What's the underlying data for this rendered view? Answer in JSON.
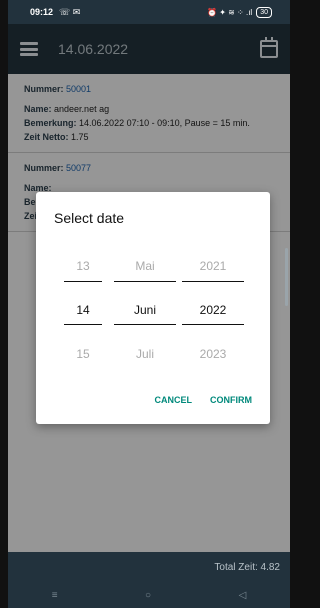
{
  "status_bar": {
    "time": "09:12",
    "left_icons": "☏ ✉",
    "right_icons": "⏰ ✦ ≋ ⁘ .ıl",
    "battery": "30"
  },
  "app_bar": {
    "date": "14.06.2022"
  },
  "entries": [
    {
      "nummer_label": "Nummer:",
      "nummer": "50001",
      "name_label": "Name:",
      "name": "andeer.net ag",
      "bemerkung_label": "Bemerkung:",
      "bemerkung": "14.06.2022 07:10 - 09:10, Pause = 15 min.",
      "zeit_label": "Zeit Netto:",
      "zeit": "1.75"
    },
    {
      "nummer_label": "Nummer:",
      "nummer": "50077",
      "name_label": "Name:",
      "name": "",
      "bemerkung_label": "Bemerkung:",
      "bemerkung": "",
      "zeit_label": "Zeit Netto:",
      "zeit": ""
    }
  ],
  "dialog": {
    "title": "Select date",
    "day": {
      "prev": "13",
      "selected": "14",
      "next": "15"
    },
    "month": {
      "prev": "Mai",
      "selected": "Juni",
      "next": "Juli"
    },
    "year": {
      "prev": "2021",
      "selected": "2022",
      "next": "2023"
    },
    "cancel": "CANCEL",
    "confirm": "CONFIRM"
  },
  "footer": {
    "total": "Total Zeit: 4.82"
  },
  "nav": {
    "menu": "≡",
    "home": "○",
    "back": "◁"
  }
}
